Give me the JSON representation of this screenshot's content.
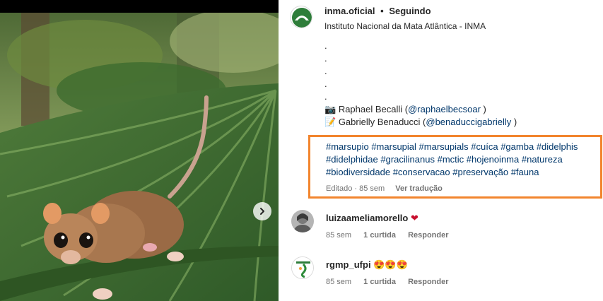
{
  "post": {
    "username": "inma.oficial",
    "separator": "•",
    "follow_status": "Seguindo",
    "subtitle": "Instituto Nacional da Mata Atlântica - INMA"
  },
  "caption": {
    "dots": [
      ".",
      ".",
      ".",
      ".",
      "."
    ],
    "credits": [
      {
        "icon": "📷",
        "name": "Raphael Becalli (",
        "handle": "@raphaelbecsoar",
        "close": " )"
      },
      {
        "icon": "📝",
        "name": "Gabrielly Benaducci (",
        "handle": "@benaduccigabrielly",
        "close": " )"
      }
    ],
    "hashtags": [
      "#marsupio",
      "#marsupial",
      "#marsupials",
      "#cuíca",
      "#gamba",
      "#didelphis",
      "#didelphidae",
      "#gracilinanus",
      "#mctic",
      "#hojenoinma",
      "#natureza",
      "#biodiversidade",
      "#conservacao",
      "#preservação",
      "#fauna"
    ],
    "edited": "Editado · 85 sem",
    "see_translation": "Ver tradução"
  },
  "comments": [
    {
      "user": "luizaameliamorello",
      "text": "❤",
      "age": "85 sem",
      "likes": "1 curtida",
      "reply": "Responder"
    },
    {
      "user": "rgmp_ufpi",
      "text": "😍😍😍",
      "age": "85 sem",
      "likes": "1 curtida",
      "reply": "Responder"
    }
  ],
  "colors": {
    "accent_link": "#00376b",
    "highlight_border": "#f2852e",
    "heart": "#c8102e",
    "muted": "#737373"
  },
  "icons": {
    "next": "chevron-right-icon",
    "heart": "heart-icon"
  }
}
